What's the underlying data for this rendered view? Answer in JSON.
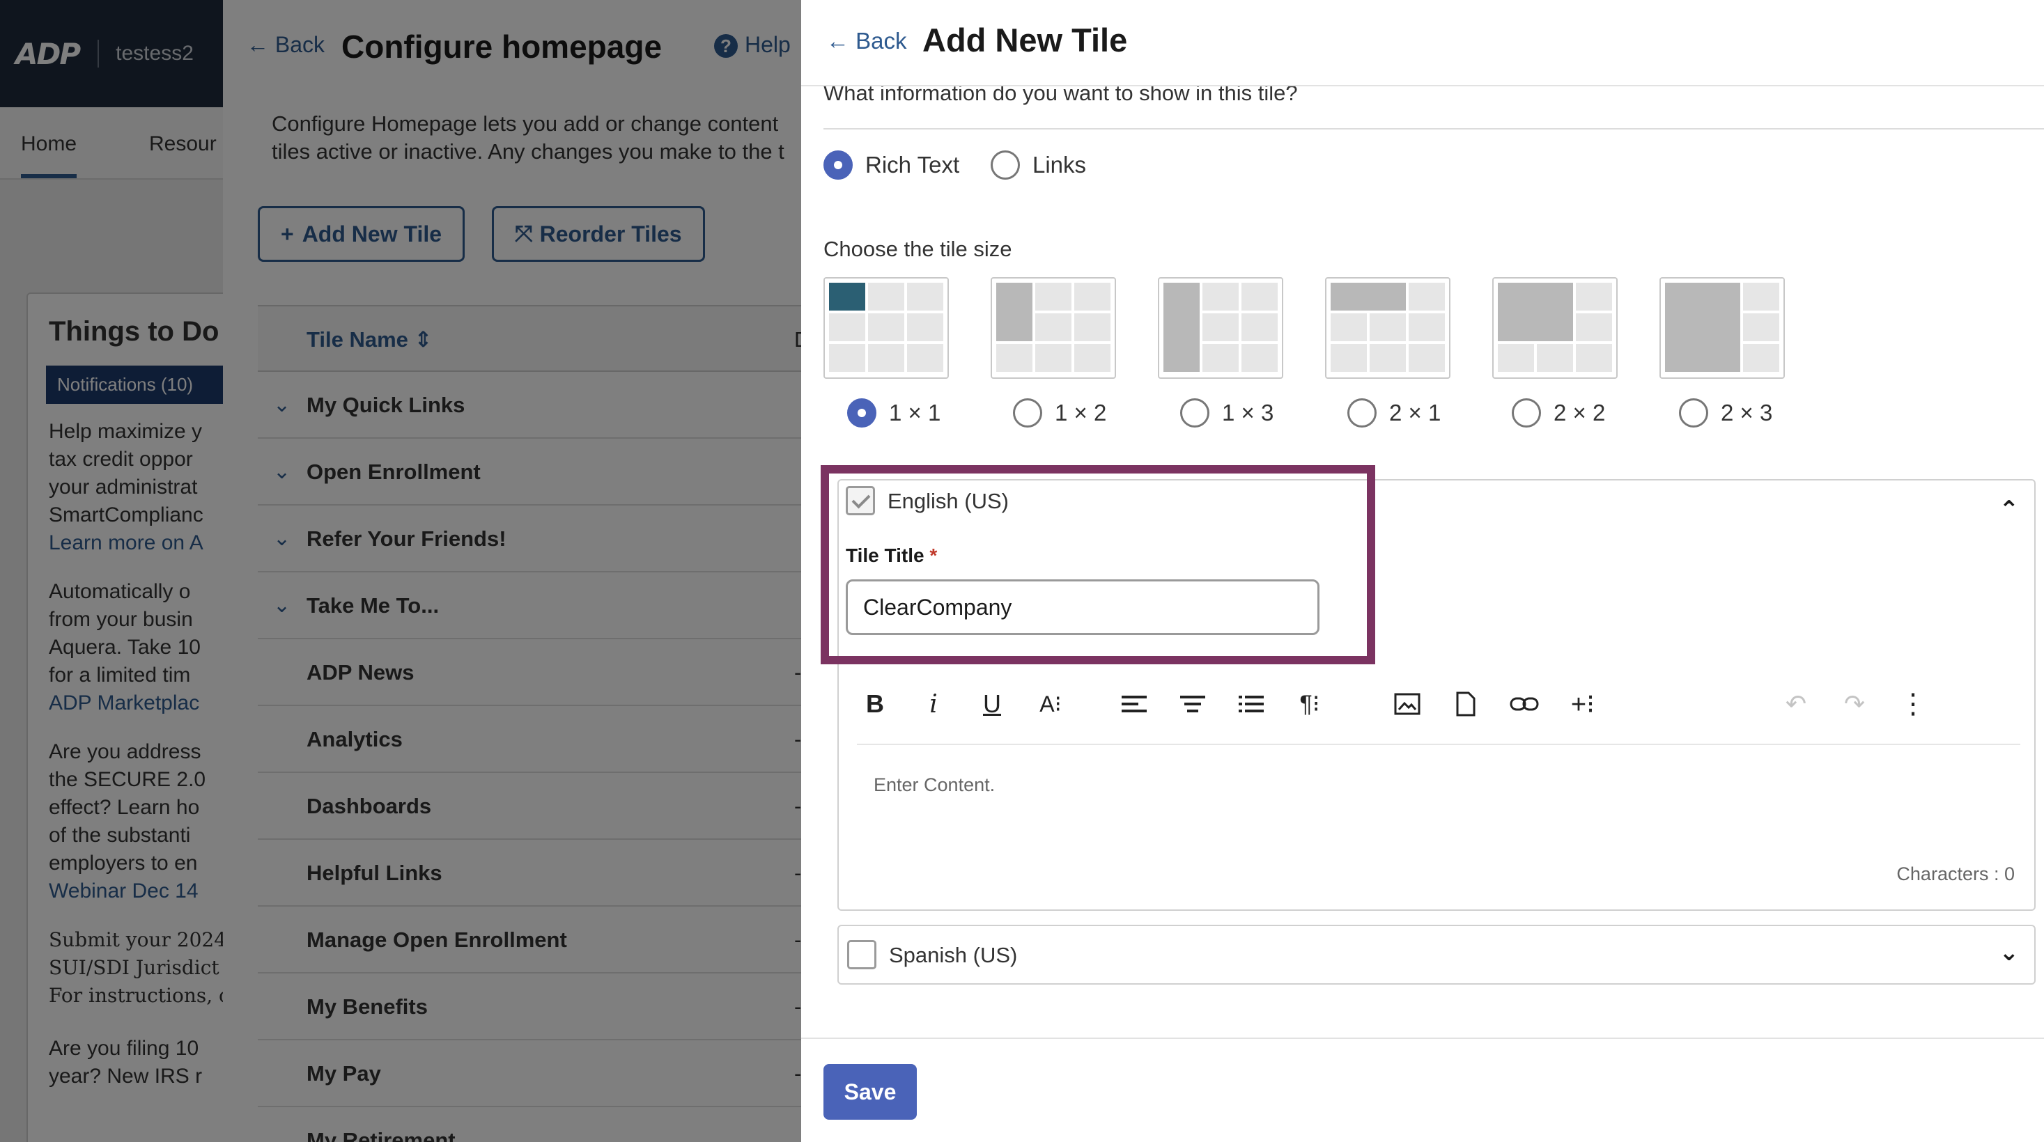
{
  "app": {
    "logo": "ADP",
    "tenant": "testess2",
    "nav_tabs": [
      "Home",
      "Resour"
    ]
  },
  "things_to_do": {
    "title": "Things to Do",
    "notifications_label": "Notifications (10)",
    "items": [
      {
        "lines": [
          "Help maximize y",
          "tax credit oppor",
          "your administrat",
          "SmartComplianc"
        ],
        "link": "Learn more on A"
      },
      {
        "lines": [
          "Automatically o",
          "from your busin",
          "Aquera. Take 10",
          "for a limited tim"
        ],
        "link": "ADP Marketplac"
      },
      {
        "lines": [
          "Are you address",
          "the SECURE 2.0",
          "effect? Learn ho",
          "of the substanti",
          "employers to en"
        ],
        "link": "Webinar Dec 14"
      },
      {
        "lines": [
          "Submit your 2024",
          "SUI/SDI Jurisdict",
          "For instructions, c"
        ],
        "link": ""
      },
      {
        "lines": [
          "Are you filing 10",
          "year? New IRS r"
        ],
        "link": ""
      }
    ]
  },
  "configure": {
    "back_label": "Back",
    "title": "Configure homepage",
    "help_label": "Help",
    "description_line1": "Configure Homepage lets you add or change content",
    "description_line2": "tiles active or inactive. Any changes you make to the t",
    "add_tile_label": "Add New Tile",
    "reorder_label": "Reorder Tiles",
    "col_tile_name": "Tile Name",
    "col_description": "Des",
    "rows": [
      {
        "name": "My Quick Links",
        "desc": "",
        "expandable": true
      },
      {
        "name": "Open Enrollment",
        "desc": "",
        "expandable": true
      },
      {
        "name": "Refer Your Friends!",
        "desc": "",
        "expandable": true
      },
      {
        "name": "Take Me To...",
        "desc": "",
        "expandable": true
      },
      {
        "name": "ADP News",
        "desc": "--",
        "expandable": false
      },
      {
        "name": "Analytics",
        "desc": "--",
        "expandable": false
      },
      {
        "name": "Dashboards",
        "desc": "--",
        "expandable": false
      },
      {
        "name": "Helpful Links",
        "desc": "--",
        "expandable": false
      },
      {
        "name": "Manage Open Enrollment",
        "desc": "--",
        "expandable": false
      },
      {
        "name": "My Benefits",
        "desc": "--",
        "expandable": false
      },
      {
        "name": "My Pay",
        "desc": "--",
        "expandable": false
      },
      {
        "name": "My Retirement",
        "desc": "",
        "expandable": false
      }
    ]
  },
  "drawer": {
    "back_label": "Back",
    "title": "Add New Tile",
    "question": "What information do you want to show in this tile?",
    "content_types": [
      {
        "label": "Rich Text",
        "checked": true
      },
      {
        "label": "Links",
        "checked": false
      }
    ],
    "size_label": "Choose the tile size",
    "sizes": [
      {
        "label": "1 × 1",
        "checked": true
      },
      {
        "label": "1 × 2",
        "checked": false
      },
      {
        "label": "1 × 3",
        "checked": false
      },
      {
        "label": "2 × 1",
        "checked": false
      },
      {
        "label": "2 × 2",
        "checked": false
      },
      {
        "label": "2 × 3",
        "checked": false
      }
    ],
    "english": {
      "label": "English (US)",
      "checked": true,
      "tile_title_label": "Tile Title",
      "required_mark": "*",
      "tile_title_value": "ClearCompany",
      "editor_placeholder": "Enter Content.",
      "char_count": "Characters : 0"
    },
    "toolbar_icons": [
      "bold-icon",
      "italic-icon",
      "underline-icon",
      "font-size-icon",
      "align-left-icon",
      "align-center-icon",
      "ordered-list-icon",
      "paragraph-format-icon",
      "insert-image-icon",
      "insert-file-icon",
      "insert-link-icon",
      "more-insert-icon",
      "undo-icon",
      "redo-icon",
      "more-options-icon"
    ],
    "spanish": {
      "label": "Spanish (US)",
      "checked": false
    },
    "save_label": "Save"
  },
  "colors": {
    "accent": "#4a63b8",
    "highlight_frame": "#7b3361",
    "brand_dark": "#1f2b3d",
    "link": "#2e5a8f"
  }
}
